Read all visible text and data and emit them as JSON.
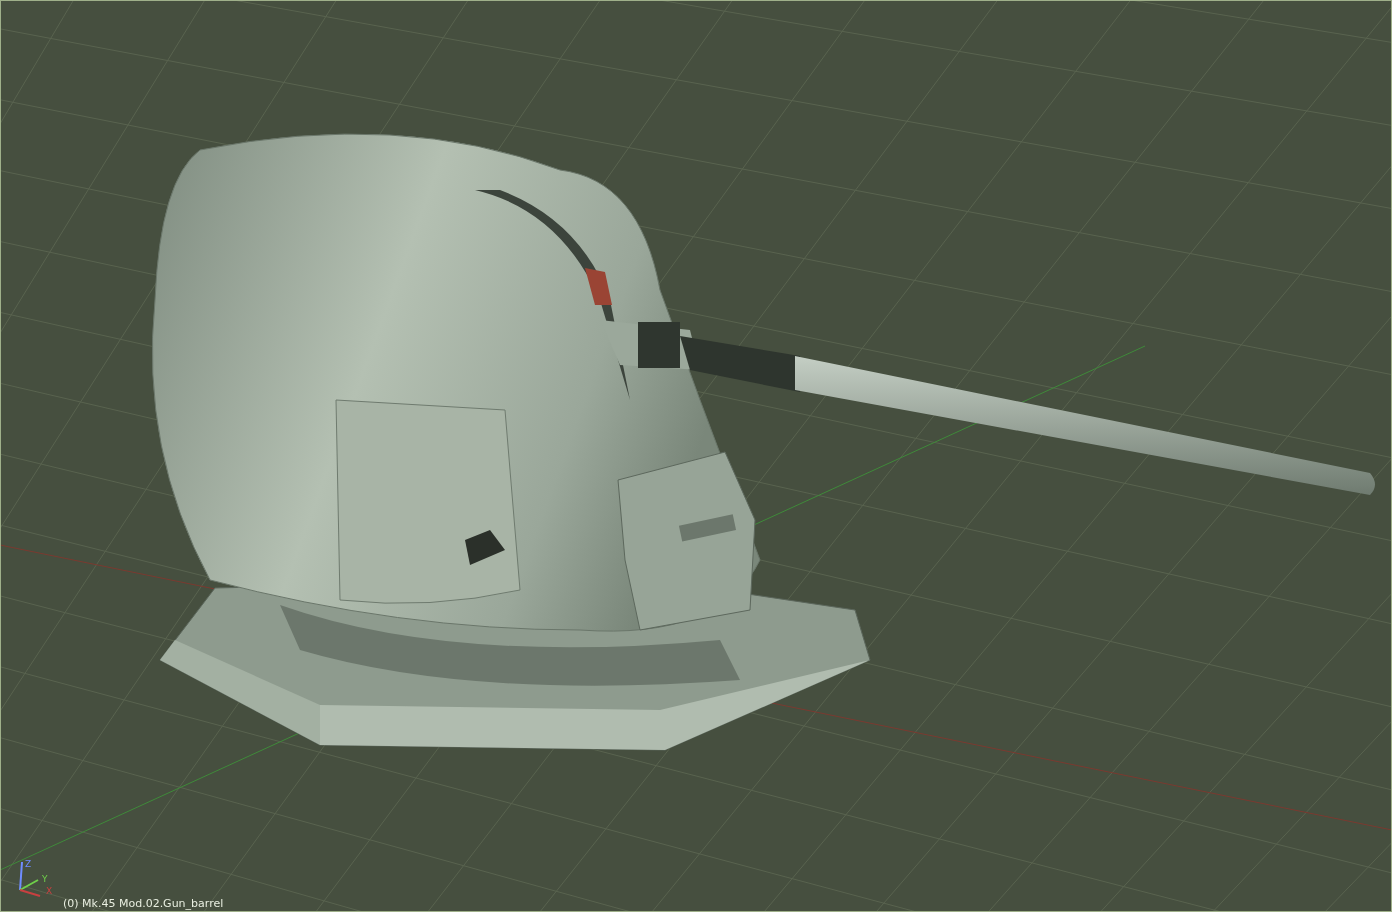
{
  "viewport": {
    "object_label": "(0) Mk.45 Mod.02.Gun_barrel",
    "axes": [
      {
        "label": "Z",
        "color": "#6f8cff"
      },
      {
        "label": "Y",
        "color": "#6fd04a"
      },
      {
        "label": "X",
        "color": "#c84040"
      }
    ]
  }
}
